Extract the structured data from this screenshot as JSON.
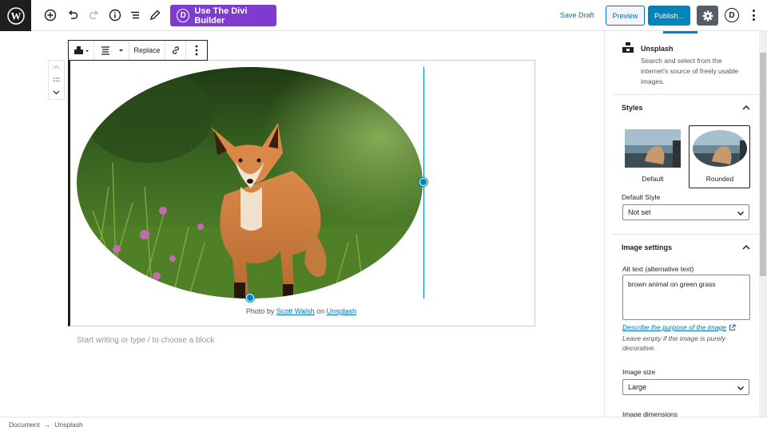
{
  "toolbar": {
    "divi_label": "Use The Divi Builder",
    "divi_glyph": "D",
    "save_draft": "Save Draft",
    "preview": "Preview",
    "publish": "Publish...",
    "divi_icon_letter": "D"
  },
  "block_toolbar": {
    "replace": "Replace"
  },
  "image": {
    "caption_prefix": "Photo by",
    "author": "Scott Walsh",
    "caption_mid": "on",
    "source": "Unsplash"
  },
  "editor": {
    "placeholder": "Start writing or type / to choose a block"
  },
  "sidebar": {
    "block_name": "Unsplash",
    "block_description": "Search and select from the internet's source of freely usable images.",
    "styles_title": "Styles",
    "styles": [
      {
        "label": "Default",
        "selected": false
      },
      {
        "label": "Rounded",
        "selected": true
      }
    ],
    "default_style_label": "Default Style",
    "default_style_value": "Not set",
    "image_settings_title": "Image settings",
    "alt_label": "Alt text (alternative text)",
    "alt_value": "brown animal on green grass",
    "alt_help_link": "Describe the purpose of the image",
    "alt_help_text": "Leave empty if the image is purely decorative.",
    "image_size_label": "Image size",
    "image_size_value": "Large",
    "image_dimensions_label": "Image dimensions"
  },
  "statusbar": {
    "crumbs": [
      "Document",
      "Unsplash"
    ],
    "arrow": "→"
  },
  "colors": {
    "accent": "#0085ba",
    "divi": "#7e3bd0",
    "link": "#0073aa"
  }
}
